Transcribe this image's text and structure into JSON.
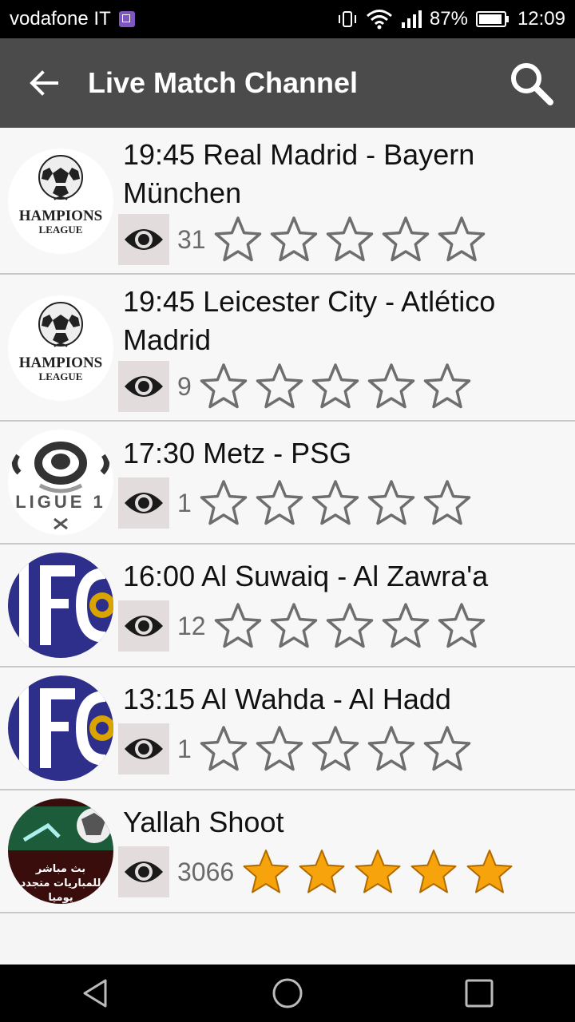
{
  "status": {
    "carrier": "vodafone IT",
    "battery": "87%",
    "time": "12:09"
  },
  "toolbar": {
    "title": "Live Match Channel"
  },
  "colors": {
    "toolbar": "#4b4b4b",
    "star_filled": "#f7a30c",
    "star_outline": "#6e6e6e",
    "eye_bg": "#e3dcdc"
  },
  "items": [
    {
      "time": "19:45",
      "title": "19:45 Real Madrid - Bayern München",
      "views": "31",
      "rating": 0,
      "logo": "champions-league"
    },
    {
      "time": "19:45",
      "title": "19:45 Leicester City - Atlético Madrid",
      "views": "9",
      "rating": 0,
      "logo": "champions-league"
    },
    {
      "time": "17:30",
      "title": "17:30 Metz - PSG",
      "views": "1",
      "rating": 0,
      "logo": "ligue-1"
    },
    {
      "time": "16:00",
      "title": "16:00 Al Suwaiq - Al Zawra'a",
      "views": "12",
      "rating": 0,
      "logo": "fc-crest"
    },
    {
      "time": "13:15",
      "title": "13:15 Al Wahda - Al Hadd",
      "views": "1",
      "rating": 0,
      "logo": "fc-crest"
    },
    {
      "time": "",
      "title": "Yallah Shoot",
      "views": "3066",
      "rating": 5,
      "logo": "yallah-shoot",
      "logo_text": "بث مباشر للمباريات متجدد يوميا"
    }
  ]
}
